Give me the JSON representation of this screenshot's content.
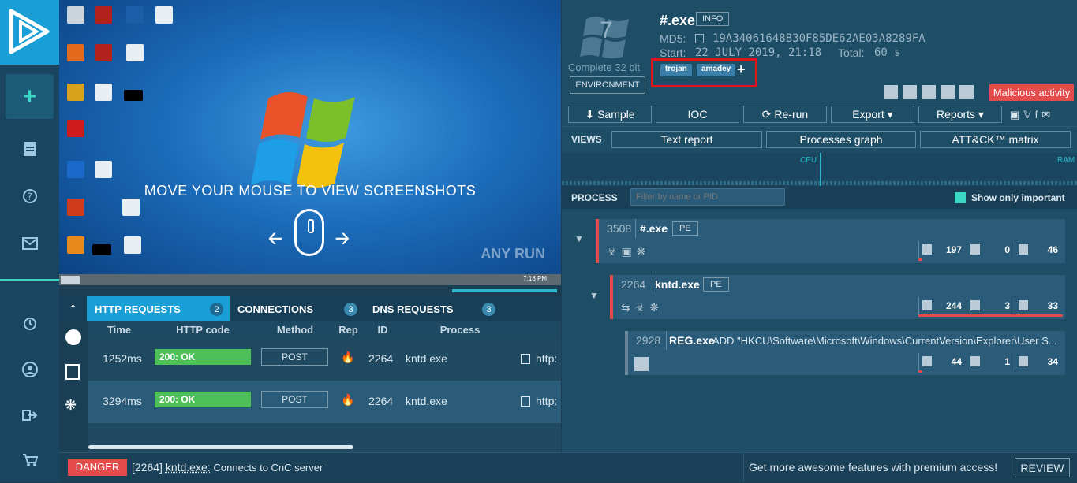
{
  "screenshot_overlay": {
    "text": "MOVE YOUR MOUSE TO VIEW SCREENSHOTS",
    "watermark": "ANY RUN",
    "clock": "7:18 PM"
  },
  "bottom_tabs": [
    {
      "label": "HTTP REQUESTS",
      "count": "2"
    },
    {
      "label": "CONNECTIONS",
      "count": "3"
    },
    {
      "label": "DNS REQUESTS",
      "count": "3"
    }
  ],
  "http_table": {
    "headers": [
      "Time",
      "HTTP code",
      "Method",
      "Rep",
      "ID",
      "Process"
    ],
    "rows": [
      {
        "time": "1252ms",
        "code": "200: OK",
        "method": "POST",
        "id": "2264",
        "process": "kntd.exe",
        "url": "http:"
      },
      {
        "time": "3294ms",
        "code": "200: OK",
        "method": "POST",
        "id": "2264",
        "process": "kntd.exe",
        "url": "http:"
      }
    ]
  },
  "status": {
    "danger_label": "DANGER",
    "message_pid": "[2264]",
    "message_proc": "kntd.exe:",
    "message_text": "Connects to CnC server",
    "promo": "Get more awesome features with premium access!",
    "review": "REVIEW"
  },
  "task": {
    "os_label": "Complete 32 bit",
    "os_number": "7",
    "filename": "#.exe",
    "info_label": "INFO",
    "md5_label": "MD5:",
    "md5": "19A34061648B30F85DE62AE03A8289FA",
    "start_label": "Start:",
    "start": "22 JULY 2019, 21:18",
    "total_label": "Total:",
    "total": "60 s",
    "environment_label": "ENVIRONMENT",
    "tags": [
      "trojan",
      "amadey"
    ],
    "verdict": "Malicious activity"
  },
  "actions": {
    "sample": "Sample",
    "ioc": "IOC",
    "rerun": "Re-run",
    "export": "Export",
    "reports": "Reports"
  },
  "views": {
    "label": "VIEWS",
    "text_report": "Text report",
    "processes_graph": "Processes graph",
    "attck": "ATT&CK™ matrix"
  },
  "graph": {
    "cpu": "CPU",
    "ram": "RAM"
  },
  "process_panel": {
    "label": "PROCESS",
    "filter_placeholder": "Filter by name or PID",
    "show_important": "Show only important",
    "processes": [
      {
        "pid": "3508",
        "name": "#.exe",
        "type": "PE",
        "files": "197",
        "reg": "0",
        "mods": "46",
        "files_fill": 0.02
      },
      {
        "pid": "2264",
        "name": "kntd.exe",
        "type": "PE",
        "files": "244",
        "reg": "3",
        "mods": "33",
        "files_fill": 1.0
      },
      {
        "pid": "2928",
        "name": "REG.exe",
        "cmd": "ADD \"HKCU\\Software\\Microsoft\\Windows\\CurrentVersion\\Explorer\\User S...",
        "files": "44",
        "reg": "1",
        "mods": "34",
        "files_fill": 0.02
      }
    ]
  },
  "colors": {
    "danger": "#e44b4b",
    "ok": "#4fbf5a",
    "accent": "#1a9ed6"
  }
}
